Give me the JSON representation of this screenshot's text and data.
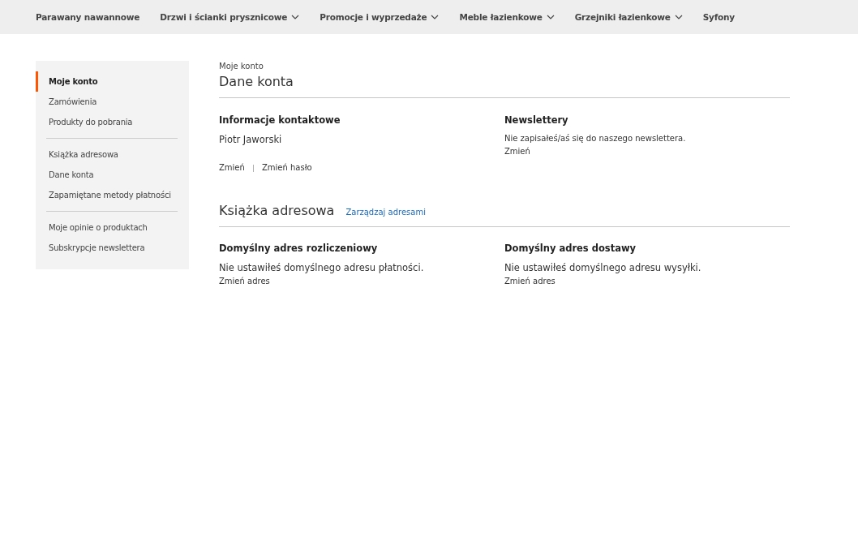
{
  "nav": [
    {
      "label": "Parawany nawannowe",
      "dropdown": false
    },
    {
      "label": "Drzwi i ścianki prysznicowe",
      "dropdown": true
    },
    {
      "label": "Promocje i wyprzedaże",
      "dropdown": true
    },
    {
      "label": "Meble łazienkowe",
      "dropdown": true
    },
    {
      "label": "Grzejniki łazienkowe",
      "dropdown": true
    },
    {
      "label": "Syfony",
      "dropdown": false
    }
  ],
  "sidebar": {
    "groups": [
      [
        {
          "label": "Moje konto",
          "selected": true
        },
        {
          "label": "Zamówienia",
          "selected": false
        },
        {
          "label": "Produkty do pobrania",
          "selected": false
        }
      ],
      [
        {
          "label": "Książka adresowa",
          "selected": false
        },
        {
          "label": "Dane konta",
          "selected": false
        },
        {
          "label": "Zapamiętane metody płatności",
          "selected": false
        }
      ],
      [
        {
          "label": "Moje opinie o produktach",
          "selected": false
        },
        {
          "label": "Subskrypcje newslettera",
          "selected": false
        }
      ]
    ]
  },
  "breadcrumb": "Moje konto",
  "page_title": "Dane konta",
  "contact": {
    "title": "Informacje kontaktowe",
    "name": "Piotr Jaworski",
    "links": [
      "Zmień",
      "Zmień hasło"
    ],
    "separator": "|"
  },
  "newsletter": {
    "title": "Newslettery",
    "text": "Nie zapisałeś/aś się do naszego newslettera.",
    "link": "Zmień"
  },
  "address_book": {
    "title": "Książka adresowa",
    "manage_link": "Zarządzaj adresami",
    "boxes": [
      {
        "title": "Domyślny adres rozliczeniowy",
        "text": "Nie ustawiłeś domyślnego adresu płatności.",
        "link": "Zmień adres"
      },
      {
        "title": "Domyślny adres dostawy",
        "text": "Nie ustawiłeś domyślnego adresu wysyłki.",
        "link": "Zmień adres"
      }
    ]
  }
}
